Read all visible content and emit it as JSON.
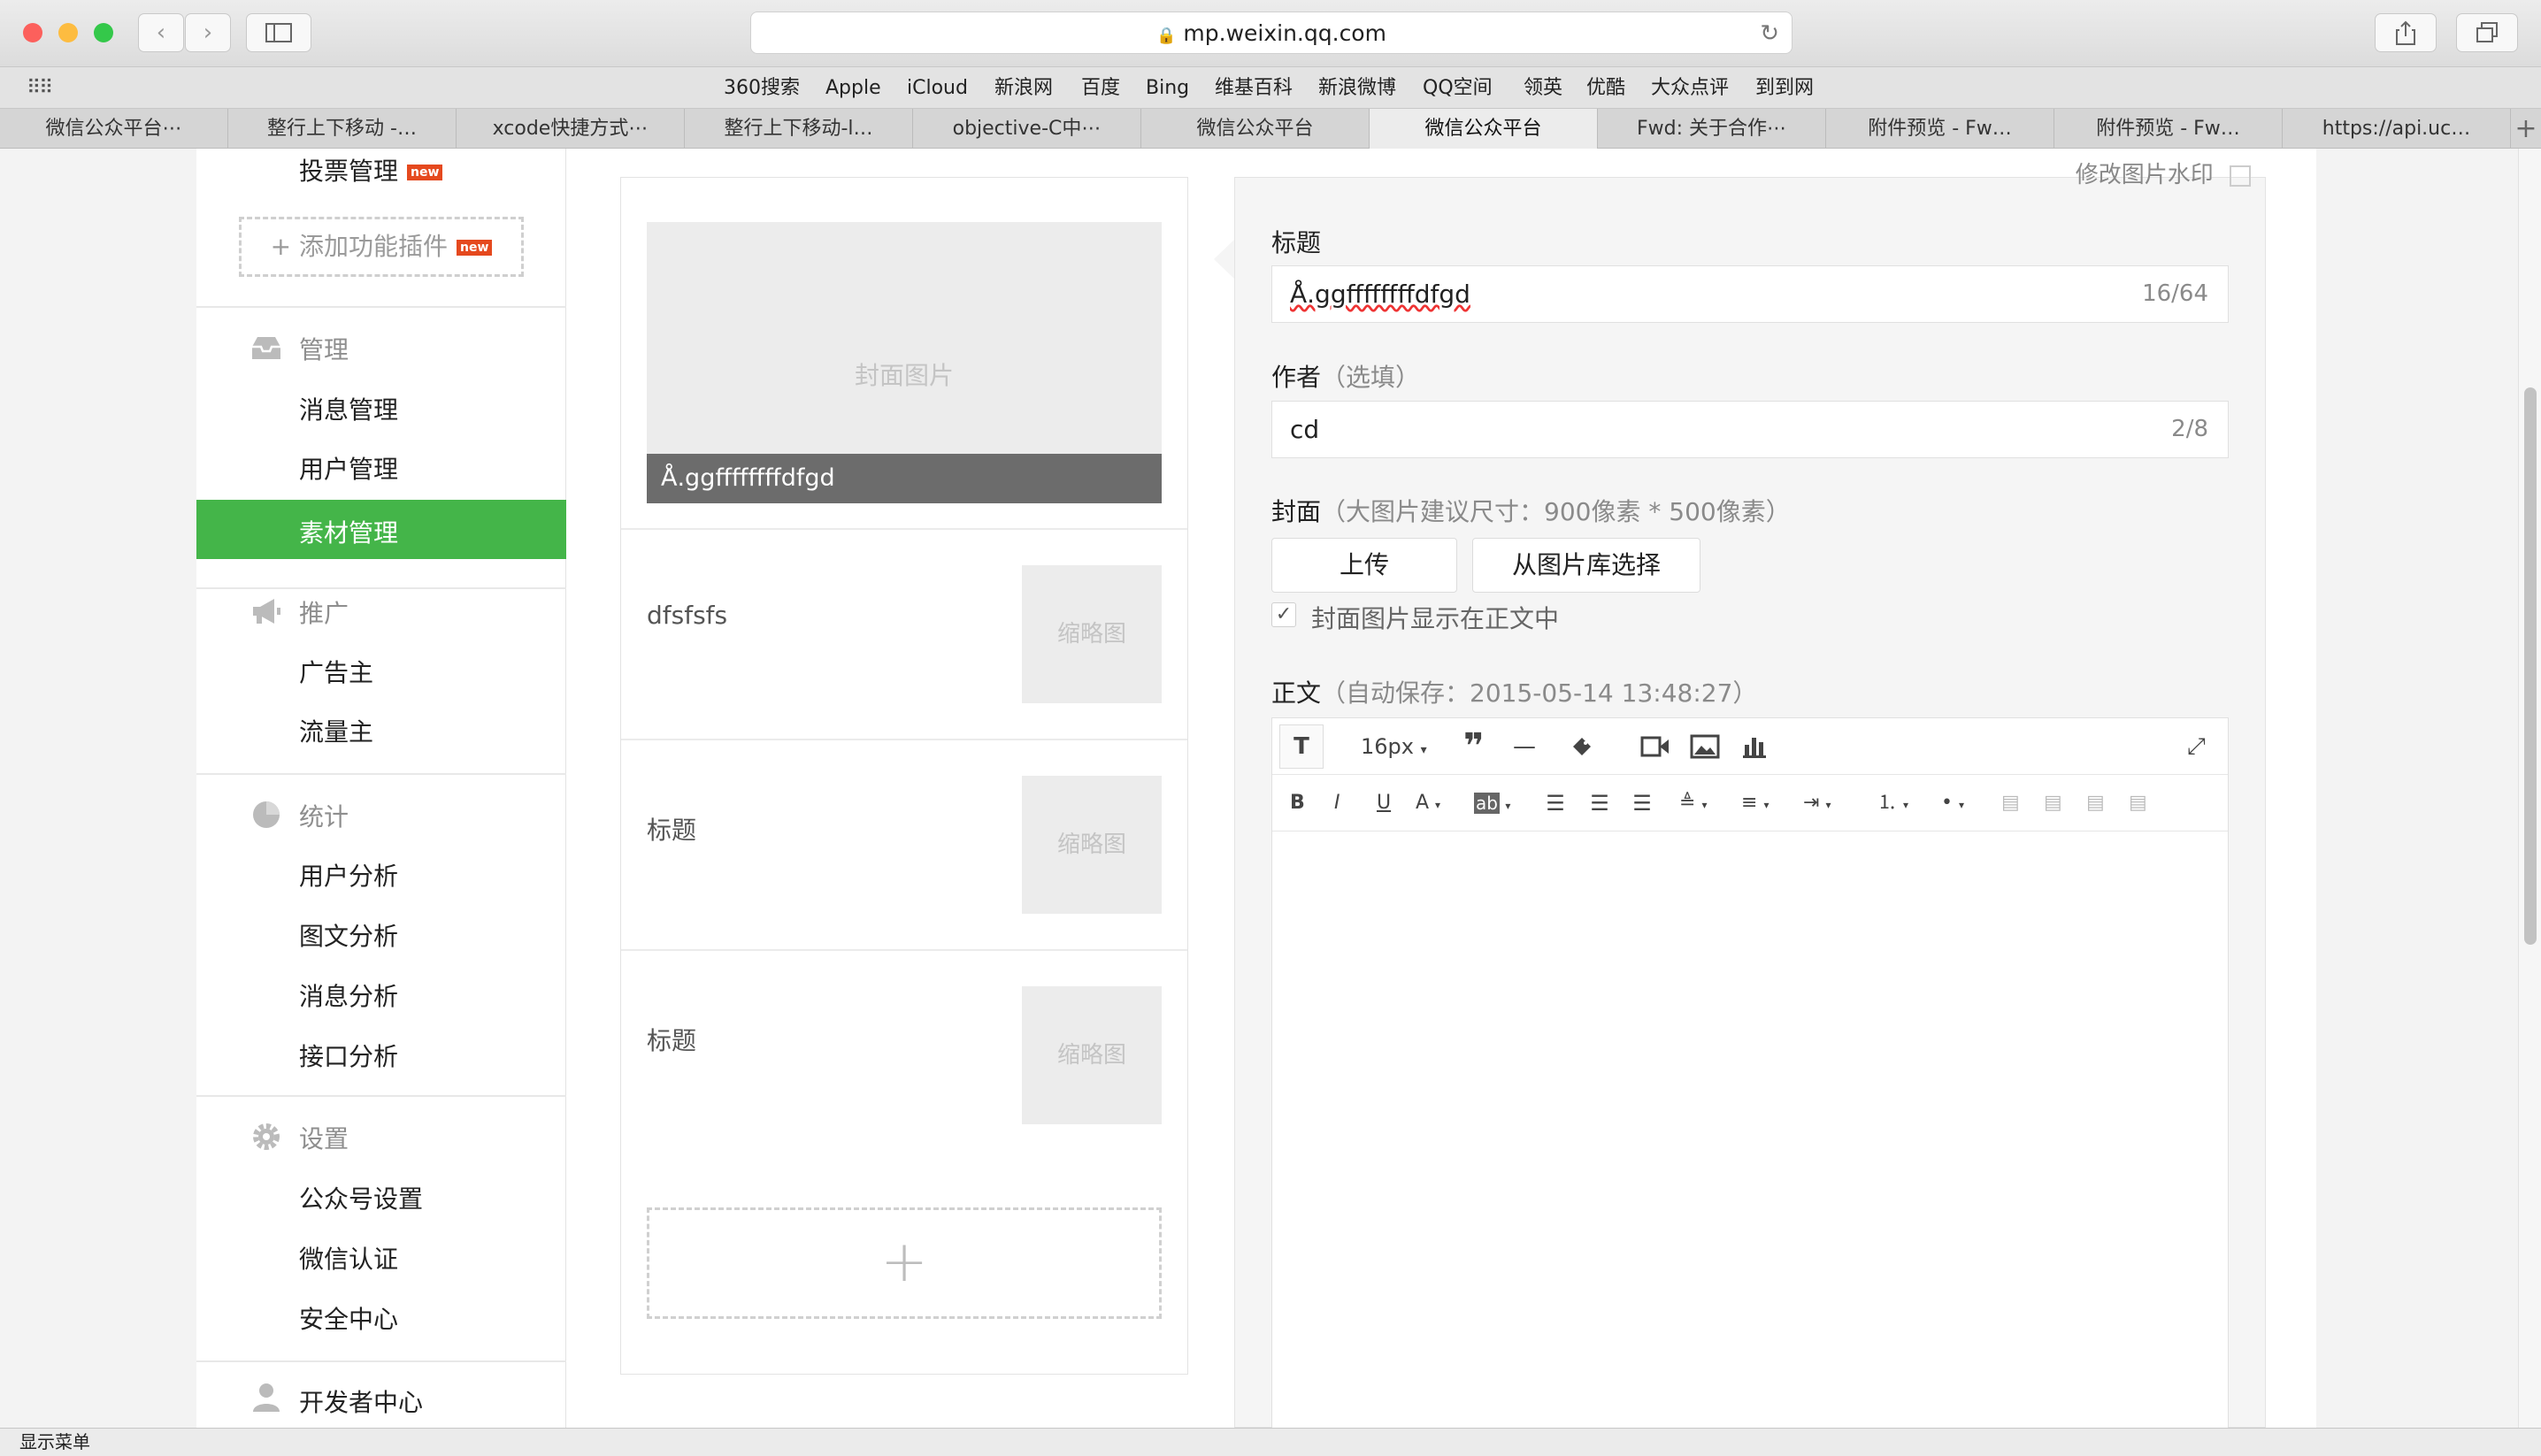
{
  "browser": {
    "url": "mp.weixin.qq.com",
    "bookmarks": [
      "360搜索",
      "Apple",
      "iCloud",
      "新浪网",
      "百度",
      "Bing",
      "维基百科",
      "新浪微博",
      "QQ空间",
      "领英",
      "优酷",
      "大众点评",
      "到到网"
    ],
    "tabs": [
      "微信公众平台⋯",
      "整行上下移动 -…",
      "xcode快捷方式⋯",
      "整行上下移动-l…",
      "objective-C中⋯",
      "微信公众平台",
      "微信公众平台",
      "Fwd: 关于合作⋯",
      "附件预览 - Fw…",
      "附件预览 - Fw…",
      "https://api.uc…"
    ],
    "active_tab_index": 6,
    "status": "显示菜单"
  },
  "sidebar": {
    "vote": "投票管理",
    "new_badge": "new",
    "add_plugin": "添加功能插件",
    "sections": [
      {
        "title": "管理",
        "icon": "inbox-icon",
        "items": [
          "消息管理",
          "用户管理",
          "素材管理"
        ]
      },
      {
        "title": "推广",
        "icon": "megaphone-icon",
        "items": [
          "广告主",
          "流量主"
        ]
      },
      {
        "title": "统计",
        "icon": "pie-chart-icon",
        "items": [
          "用户分析",
          "图文分析",
          "消息分析",
          "接口分析"
        ]
      },
      {
        "title": "设置",
        "icon": "gear-icon",
        "items": [
          "公众号设置",
          "微信认证",
          "安全中心"
        ]
      }
    ],
    "developer": "开发者中心",
    "active_item": "素材管理"
  },
  "articles": {
    "cover_placeholder": "封面图片",
    "cover_title": "Å.ggffffffffdfgd",
    "items": [
      {
        "title": "dfsfsfs",
        "thumb": "缩略图"
      },
      {
        "title": "标题",
        "thumb": "缩略图"
      },
      {
        "title": "标题",
        "thumb": "缩略图"
      }
    ],
    "add": "+"
  },
  "editor": {
    "top_partial": "修改图片水印",
    "title_label": "标题",
    "title_value": "Å.ggffffffffdfgd",
    "title_count": "16/64",
    "author_label": "作者",
    "author_hint": "（选填）",
    "author_value": "cd",
    "author_count": "2/8",
    "cover_label": "封面",
    "cover_hint": "（大图片建议尺寸：900像素 * 500像素）",
    "upload": "上传",
    "from_library": "从图片库选择",
    "show_in_body": "封面图片显示在正文中",
    "show_in_body_checked": true,
    "body_label": "正文",
    "body_hint": "（自动保存：2015-05-14 13:48:27）",
    "font_size": "16px"
  }
}
